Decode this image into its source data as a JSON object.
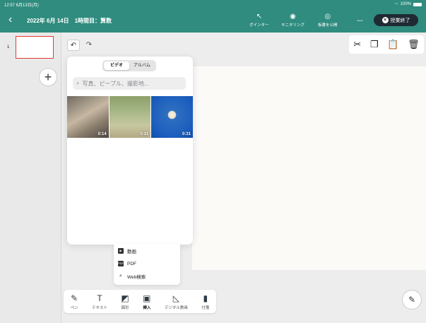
{
  "status_bar": {
    "time_date": "12:57  6月13日(月)",
    "battery": "100%"
  },
  "header": {
    "back_label": "‹",
    "title": "2022年 6月 14日　1時間目：算数",
    "tools": [
      {
        "label": "ポインター",
        "icon": "pointer-icon"
      },
      {
        "label": "モニタリング",
        "icon": "monitoring-icon"
      },
      {
        "label": "板書を公開",
        "icon": "eye-icon"
      }
    ],
    "more": "…",
    "end_button": "授業終了"
  },
  "sidebar": {
    "page_number": "1",
    "add_label": "+"
  },
  "picker": {
    "tabs": [
      "ビデオ",
      "アルバム"
    ],
    "active_tab": "ビデオ",
    "search_placeholder": "写真、ピープル、撮影地...",
    "videos": [
      {
        "duration": "0:14"
      },
      {
        "duration": "0:31"
      },
      {
        "duration": "0:31"
      }
    ]
  },
  "insert_menu": {
    "items": [
      "動画",
      "PDF",
      "Web検索"
    ]
  },
  "toolbar": {
    "items": [
      "ペン",
      "テキスト",
      "図形",
      "挿入",
      "デジタル教具",
      "付箋"
    ],
    "active": "挿入"
  }
}
